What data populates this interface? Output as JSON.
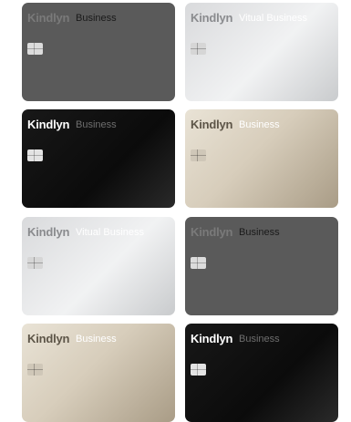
{
  "cards": [
    {
      "brand": "Kindlyn",
      "tier": "Business",
      "style": "gray"
    },
    {
      "brand": "Kindlyn",
      "tier": "Vitual Business",
      "style": "silver"
    },
    {
      "brand": "Kindlyn",
      "tier": "Business",
      "style": "black"
    },
    {
      "brand": "Kindlyn",
      "tier": "Business",
      "style": "gold"
    },
    {
      "brand": "Kindlyn",
      "tier": "Vitual Business",
      "style": "silver"
    },
    {
      "brand": "Kindlyn",
      "tier": "Business",
      "style": "gray"
    },
    {
      "brand": "Kindlyn",
      "tier": "Business",
      "style": "gold"
    },
    {
      "brand": "Kindlyn",
      "tier": "Business",
      "style": "black"
    }
  ],
  "chip_icon": "card-chip-icon",
  "colors": {
    "gray": "#5a5a5a",
    "silver": "#e6e7e9",
    "black": "#111111",
    "gold": "#d7cdbb"
  }
}
